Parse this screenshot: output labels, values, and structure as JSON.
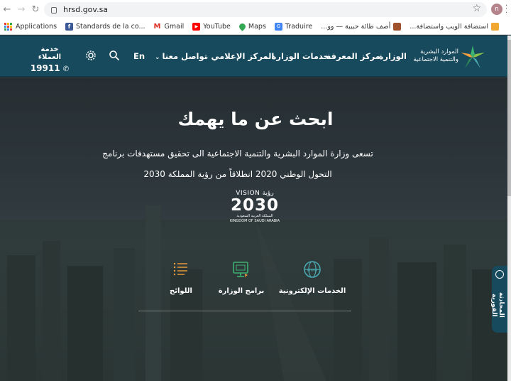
{
  "browser": {
    "url": "hrsd.gov.sa",
    "profile_initial": "n",
    "bookmarks": [
      "Applications",
      "Standards de la co...",
      "Gmail",
      "YouTube",
      "Maps",
      "Traduire",
      "أصف طائة حبيبة — وو...",
      "استضافة الويب واستضافة..."
    ]
  },
  "header": {
    "logo_text_line1": "الموارد البشرية",
    "logo_text_line2": "والتنمية الاجتماعية",
    "nav": {
      "ministry": "الوزارة",
      "knowledge": "مركز المعرفة",
      "services": "خدمات الوزارة",
      "media": "المركز الإعلامي",
      "contact": "تواصل معنا"
    },
    "language": "En",
    "hotline_title": "خدمة العملاء",
    "hotline_number": "19911"
  },
  "hero": {
    "title": "ابحث عن ما يهمك",
    "subtitle": "تسعى وزارة الموارد البشرية والتنمية الاجتماعية الى تحقيق مستهدفات برنامج التحول الوطني 2020 انطلاقاً من رؤية المملكة 2030",
    "vision": {
      "label": "VISION رؤية",
      "year": "2030",
      "ar_line": "المملكة العربية السعودية",
      "en_line": "KINGDOM OF SAUDI ARABIA"
    },
    "services": {
      "eservices": "الخدمات الإلكترونية",
      "programs": "برامج الوزارة",
      "regulations": "اللوائح"
    }
  },
  "side_tab": {
    "label": "المحادثة الفورية"
  },
  "colors": {
    "header_bg": "#174a5c",
    "accent_green": "#3cb371",
    "accent_orange": "#f2a03d",
    "accent_teal": "#4aa8b0"
  }
}
